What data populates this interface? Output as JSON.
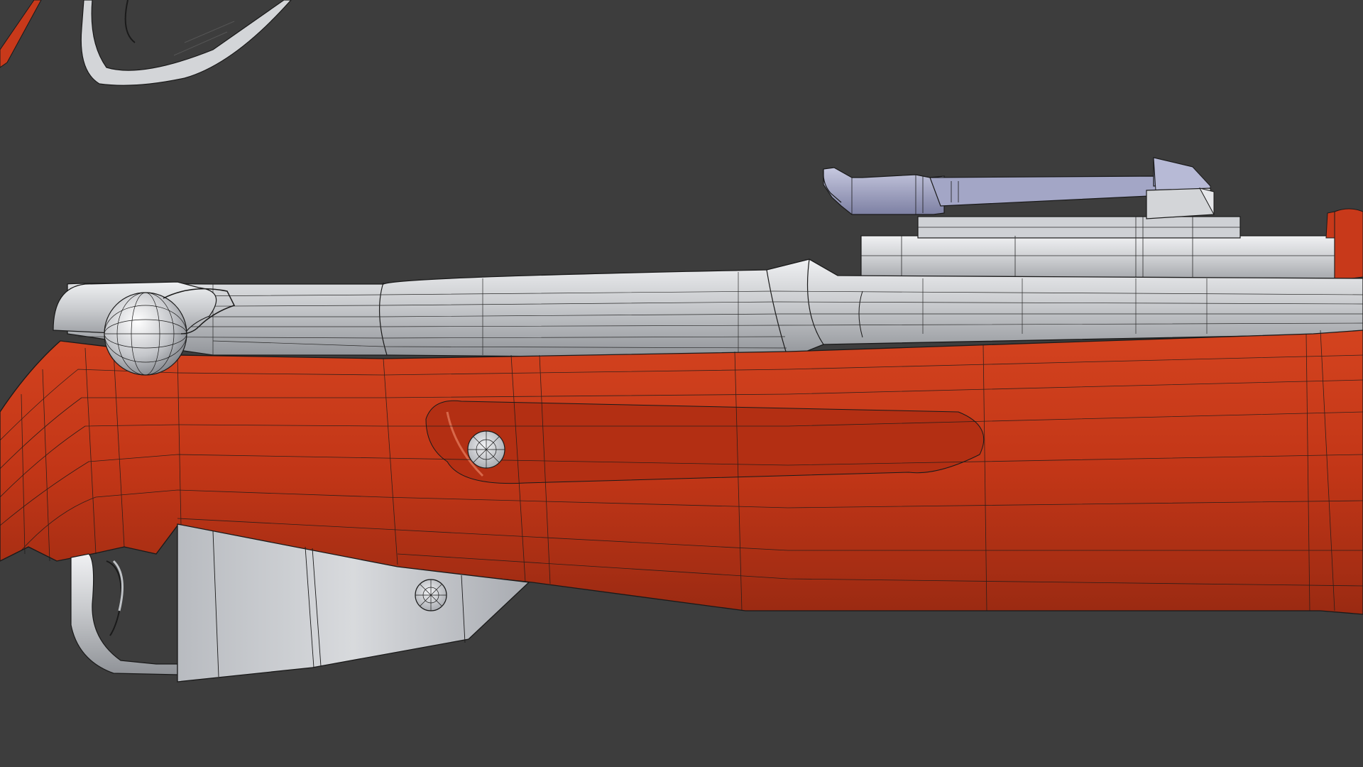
{
  "viewport": {
    "background": "#3d3d3d",
    "mode": "3d-viewport-wireframe-overlay"
  },
  "materials": {
    "stock": "#c8391a",
    "stock_shadow": "#8f2410",
    "metal": "#c9cbce",
    "metal_shadow": "#8d9096",
    "sight_metal": "#9fa3c4",
    "wire": "#1a1a1a"
  }
}
